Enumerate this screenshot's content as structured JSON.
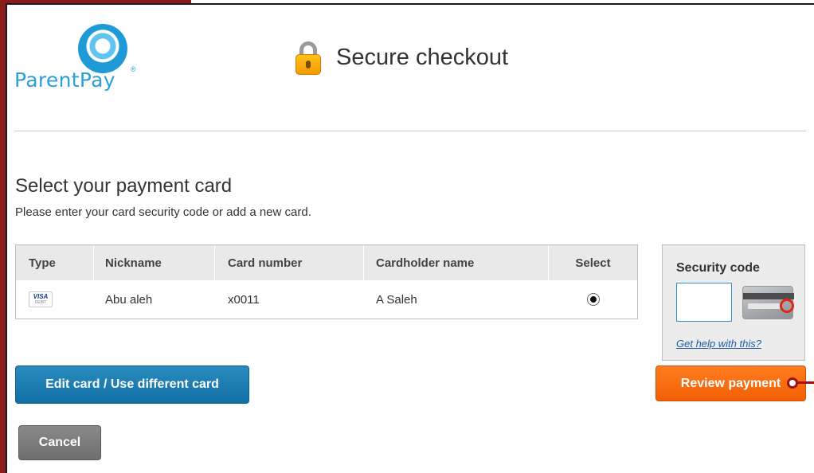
{
  "brand": {
    "name": "ParentPay",
    "reg": "®"
  },
  "header": {
    "title": "Secure checkout",
    "icon": "lock-icon"
  },
  "section": {
    "title": "Select your payment card",
    "subtitle": "Please enter your card security code or add a new card."
  },
  "cards_table": {
    "columns": [
      "Type",
      "Nickname",
      "Card number",
      "Cardholder name",
      "Select"
    ],
    "rows": [
      {
        "type_logo": "VISA",
        "type_logo_sub": "DEBIT",
        "nickname": "Abu aleh",
        "card_number": "x0011",
        "cardholder": "A Saleh",
        "selected": true
      }
    ]
  },
  "security_code": {
    "label": "Security code",
    "value": "",
    "help_link": "Get help with this?"
  },
  "buttons": {
    "edit_card": "Edit card / Use different card",
    "review_payment": "Review payment",
    "cancel": "Cancel"
  },
  "colors": {
    "brand_blue": "#2a9fd8",
    "edit_button": "#1170a6",
    "review_button": "#f25f05",
    "cancel_button": "#6e6e6e",
    "frame": "#8b1a1a"
  }
}
